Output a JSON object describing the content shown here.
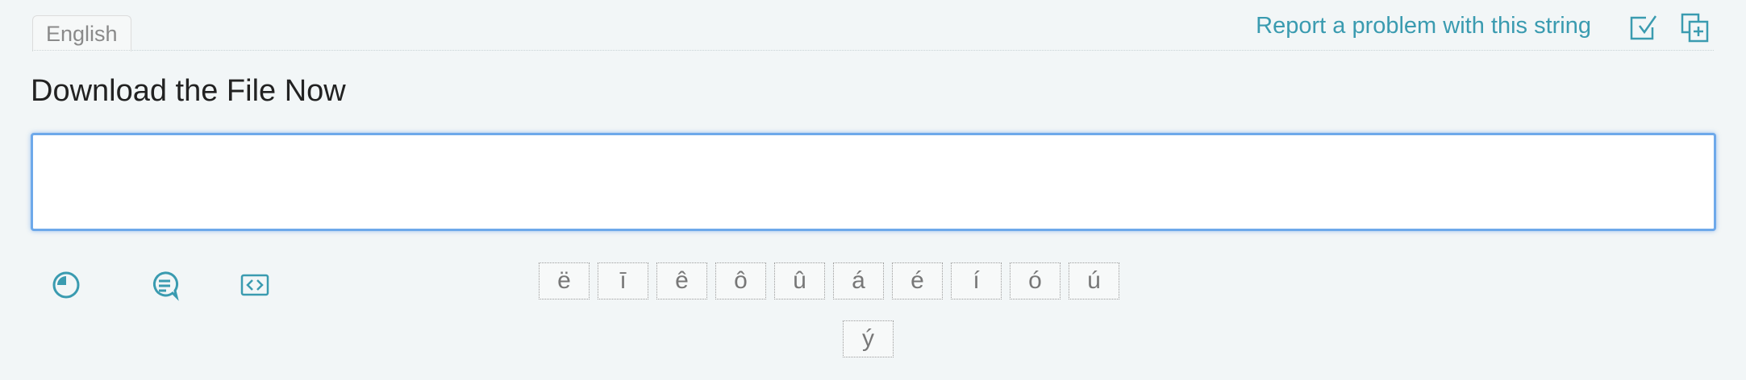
{
  "source_tab": {
    "language": "English"
  },
  "header": {
    "report_label": "Report a problem with this string",
    "icons": [
      "report-problem-icon",
      "copy-source-icon"
    ]
  },
  "source_string": "Download the File Now",
  "translation": {
    "value": "",
    "placeholder": ""
  },
  "toolbar": {
    "icons": [
      "history-icon",
      "comment-icon",
      "code-brackets-icon"
    ]
  },
  "special_characters": {
    "row1": [
      "ë",
      "ī",
      "ê",
      "ô",
      "û",
      "á",
      "é",
      "í",
      "ó",
      "ú"
    ],
    "row2": [
      "ý"
    ]
  },
  "colors": {
    "accent": "#3a9bb0",
    "input_focus": "#6ea9ea",
    "background": "#f2f6f7"
  }
}
